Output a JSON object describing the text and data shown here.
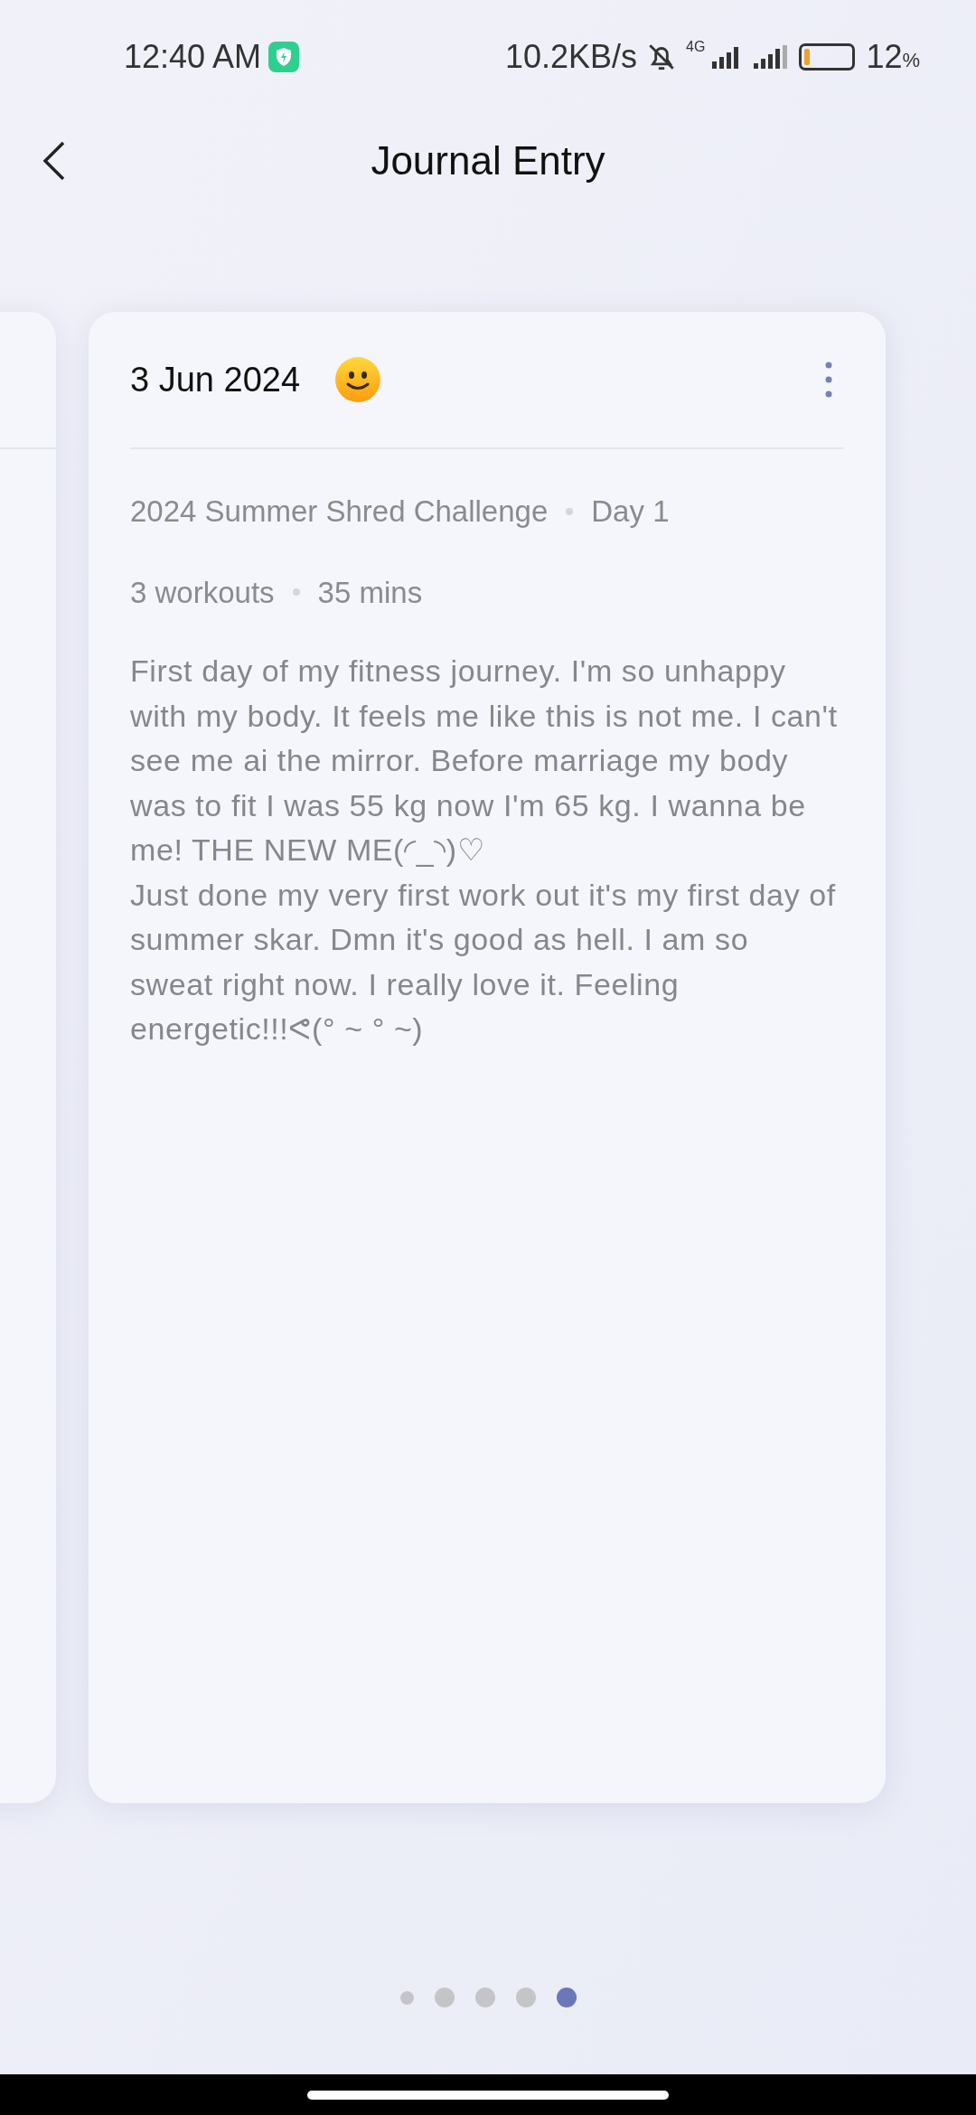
{
  "status_bar": {
    "time": "12:40 AM",
    "speed": "10.2KB/s",
    "network": "4G",
    "battery_text": "12",
    "battery_unit": "%",
    "battery": {
      "level": 0.12
    }
  },
  "header": {
    "title": "Journal Entry"
  },
  "entry": {
    "date": "3 Jun 2024",
    "challenge": "2024 Summer Shred Challenge",
    "day": "Day 1",
    "workouts": "3 workouts",
    "duration": "35 mins",
    "paragraphs": [
      "First day of my fitness journey. I'm so unhappy with my body. It feels me like this is not me. I can't see me ai the mirror. Before marriage my body was to fit I was 55 kg now I'm 65 kg. I wanna be me! THE NEW ME(◜_◝)♡",
      "Just done my very first work out it's my first day of summer skar. Dmn it's good as hell. I am so sweat right now. I really love it. Feeling energetic!!!ᕙ(° ~ ° ~)"
    ]
  },
  "pages": [
    {
      "kind": "small",
      "selected": false
    },
    {
      "kind": "normal",
      "selected": false
    },
    {
      "kind": "normal",
      "selected": false
    },
    {
      "kind": "normal",
      "selected": false
    },
    {
      "kind": "normal",
      "selected": true
    }
  ]
}
